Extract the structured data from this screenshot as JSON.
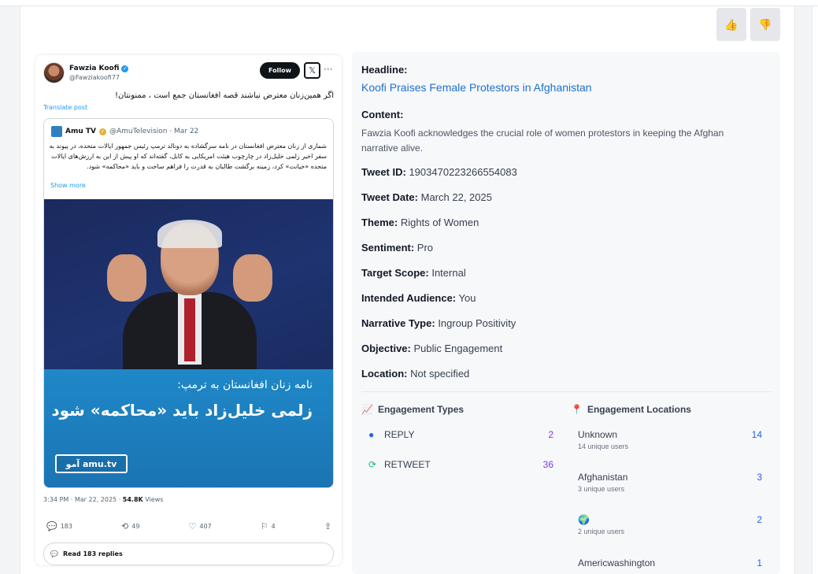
{
  "feedback": {
    "up_icon": "thumbs-up-icon",
    "down_icon": "thumbs-down-icon"
  },
  "tweet": {
    "author_name": "Fawzia Koofi",
    "author_handle": "@Fawziakoofi77",
    "follow_label": "Follow",
    "text": "اگر همین‌زنان معترض نباشند قصه افغانستان جمع است ، ممنونتان!",
    "translate_label": "Translate post",
    "quote": {
      "name": "Amu TV",
      "handle_date": "@AmuTelevision · Mar 22",
      "text": "شماری از زنان معترض افغانستان در نامه سرگشاده به دونالد ترمپ رئیس جمهور ایالات متحده، در پیوند به سفر اخیر زلمی خلیل‌زاد در چارچوب هیئت امریکایی به کابل، گفته‌اند که او پیش از این به ارزش‌های ایالات متحده «خیانت» کرد، زمینه برگشت طالبان به قدرت را فراهم ساخت و باید «محاکمه» شود.",
      "show_more": "Show more",
      "banner_line1": "نامه زنان افغانستان به ترمپ:",
      "banner_line2": "زلمی خلیل‌زاد باید «محاکمه» شود",
      "brand": "آمو amu.tv"
    },
    "time": "3:34 PM · Mar 22, 2025 ·",
    "views_count": "54.8K",
    "views_label": "Views",
    "replies": "183",
    "retweets": "49",
    "likes": "407",
    "bookmarks": "4",
    "read_replies": "Read 183 replies"
  },
  "details": {
    "headline_label": "Headline:",
    "headline": "Koofi Praises Female Protestors in Afghanistan",
    "content_label": "Content:",
    "content": "Fawzia Koofi acknowledges the crucial role of women protestors in keeping the Afghan narrative alive.",
    "fields": [
      {
        "label": "Tweet ID:",
        "value": "1903470223266554083"
      },
      {
        "label": "Tweet Date:",
        "value": "March 22, 2025"
      },
      {
        "label": "Theme:",
        "value": "Rights of Women"
      },
      {
        "label": "Sentiment:",
        "value": "Pro"
      },
      {
        "label": "Target Scope:",
        "value": "Internal"
      },
      {
        "label": "Intended Audience:",
        "value": "You"
      },
      {
        "label": "Narrative Type:",
        "value": "Ingroup Positivity"
      },
      {
        "label": "Objective:",
        "value": "Public Engagement"
      },
      {
        "label": "Location:",
        "value": "Not specified"
      }
    ]
  },
  "engagement_types": {
    "title": "Engagement Types",
    "items": [
      {
        "label": "REPLY",
        "count": "2",
        "icon": "chat-bubble-icon",
        "color": "#2563eb"
      },
      {
        "label": "RETWEET",
        "count": "36",
        "icon": "retweet-icon",
        "color": "#10b981"
      }
    ]
  },
  "engagement_locations": {
    "title": "Engagement Locations",
    "items": [
      {
        "name": "Unknown",
        "sub": "14 unique users",
        "count": "14"
      },
      {
        "name": "Afghanistan",
        "sub": "3 unique users",
        "count": "3"
      },
      {
        "name": "🌍",
        "sub": "2 unique users",
        "count": "2"
      },
      {
        "name": "Americwashington",
        "sub": "",
        "count": "1"
      }
    ]
  }
}
